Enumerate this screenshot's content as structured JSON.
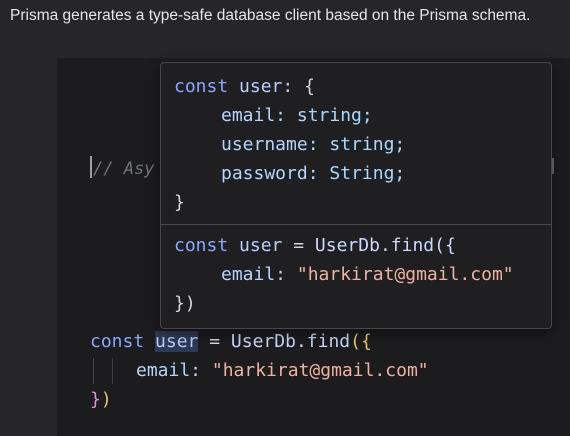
{
  "intro_text": "Prisma generates a type-safe database client based on the Prisma schema.",
  "background_comment": "// Asy",
  "main_code": {
    "line1": {
      "const": "const",
      "user": "user",
      "eq": "=",
      "call": "UserDb.find",
      "paren": "(",
      "brace": "{"
    },
    "line2": {
      "key": "email:",
      "value": "\"harkirat@gmail.com\""
    },
    "line3": {
      "brace": "}",
      "paren": ")"
    }
  },
  "hover": {
    "type_header": {
      "const": "const",
      "name": "user:",
      "brace": "{"
    },
    "fields": [
      {
        "name": "email:",
        "type": "string;"
      },
      {
        "name": "username:",
        "type": "string;"
      },
      {
        "name": "password:",
        "type": "String;"
      }
    ],
    "type_close": "}",
    "snippet": {
      "line1": {
        "const": "const",
        "user": "user",
        "eq": "=",
        "call": "UserDb.find({"
      },
      "line2": {
        "key": "email:",
        "value": "\"harkirat@gmail.com\""
      },
      "line3": "})"
    }
  },
  "colors": {
    "background": "#262628",
    "editor": "#1c1c1e",
    "keyword": "#8aa7ff",
    "string": "#f0b2a0"
  }
}
